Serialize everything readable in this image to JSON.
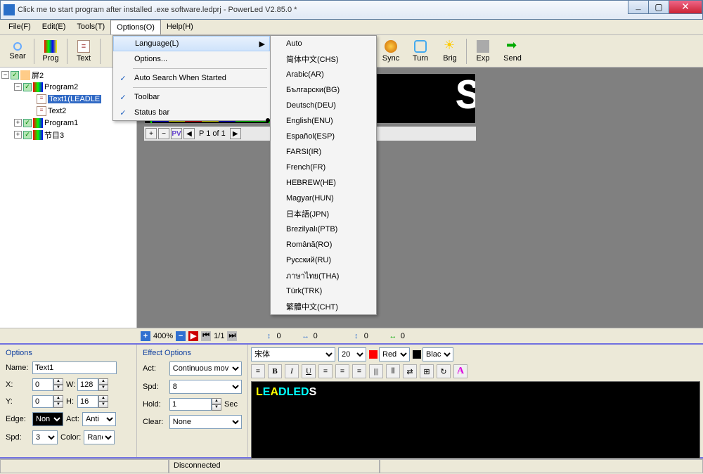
{
  "window": {
    "title": "Click me to start program after installed .exe software.ledprj - PowerLed V2.85.0 *"
  },
  "menu": {
    "file": "File(F)",
    "edit": "Edit(E)",
    "tools": "Tools(T)",
    "options": "Options(O)",
    "help": "Help(H)"
  },
  "options_menu": {
    "language": "Language(L)",
    "options": "Options...",
    "auto_search": "Auto Search When Started",
    "toolbar": "Toolbar",
    "statusbar": "Status bar"
  },
  "languages": [
    "Auto",
    "简体中文(CHS)",
    "Arabic(AR)",
    "Български(BG)",
    "Deutsch(DEU)",
    "English(ENU)",
    "Español(ESP)",
    "FARSI(IR)",
    "French(FR)",
    "HEBREW(HE)",
    "Magyar(HUN)",
    "日本語(JPN)",
    "Brezilyalı(PTB)",
    "Română(RO)",
    "Русский(RU)",
    "ภาษาไทย(THA)",
    "Türk(TRK)",
    "繁體中文(CHT)"
  ],
  "toolbar": {
    "sear": "Sear",
    "prog": "Prog",
    "text": "Text",
    "sync": "Sync",
    "turn": "Turn",
    "brig": "Brig",
    "exp": "Exp",
    "send": "Send"
  },
  "tree": {
    "root": "屏2",
    "prog2": "Program2",
    "text1": "Text1(LEADLE",
    "text2": "Text2",
    "prog1": "Program1",
    "jiemu3": "节目3"
  },
  "page_ctrl": {
    "page": "P 1 of 1"
  },
  "zoom": {
    "pct": "400%",
    "frames": "1/1",
    "v1": "0",
    "v2": "0",
    "v3": "0",
    "v4": "0"
  },
  "options_panel": {
    "title": "Options",
    "name_lbl": "Name:",
    "name": "Text1",
    "x_lbl": "X:",
    "x": "0",
    "w_lbl": "W:",
    "w": "128",
    "y_lbl": "Y:",
    "y": "0",
    "h_lbl": "H:",
    "h": "16",
    "edge_lbl": "Edge:",
    "edge": "Non",
    "act_lbl": "Act:",
    "act": "Anti",
    "spd_lbl": "Spd:",
    "spd": "3",
    "color_lbl": "Color:",
    "color": "Rand"
  },
  "effect_panel": {
    "title": "Effect Options",
    "act_lbl": "Act:",
    "act": "Continuous mov",
    "spd_lbl": "Spd:",
    "spd": "8",
    "hold_lbl": "Hold:",
    "hold": "1",
    "sec": "Sec",
    "clear_lbl": "Clear:",
    "clear": "None"
  },
  "format": {
    "font": "宋体",
    "size": "20",
    "color1": "Red",
    "color2": "Blac"
  },
  "preview": {
    "L": "L",
    "E": "E",
    "A": "A",
    "D": "D",
    "L2": "L",
    "E2": "E",
    "D2": "D",
    "S": "S"
  },
  "status": {
    "disconnected": "Disconnected"
  }
}
